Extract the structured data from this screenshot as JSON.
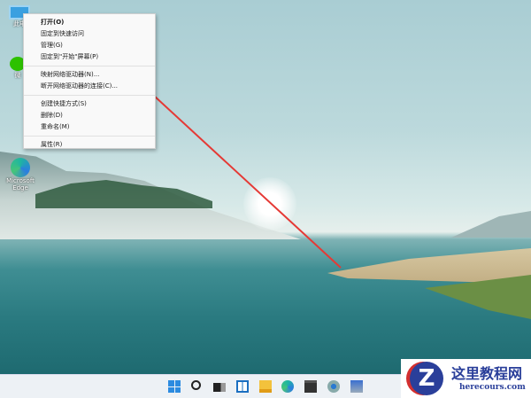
{
  "desktop": {
    "icons": [
      {
        "label": "此电",
        "icon": "this-pc-icon"
      },
      {
        "label": "微",
        "icon": "wechat-icon"
      },
      {
        "label": "Microsoft Edge",
        "icon": "edge-icon"
      }
    ]
  },
  "context_menu": {
    "groups": [
      [
        "打开(O)",
        "固定到快速访问",
        "管理(G)",
        "固定到\"开始\"屏幕(P)"
      ],
      [
        "映射网络驱动器(N)...",
        "断开网络驱动器的连接(C)..."
      ],
      [
        "创建快捷方式(S)",
        "删除(D)",
        "重命名(M)"
      ],
      [
        "属性(R)"
      ]
    ]
  },
  "annotation": {
    "arrow_color": "#e53935"
  },
  "taskbar": {
    "icons": [
      "windows-start-icon",
      "search-icon",
      "task-view-icon",
      "widgets-icon",
      "file-explorer-icon",
      "edge-icon",
      "store-icon",
      "settings-icon",
      "control-panel-icon"
    ]
  },
  "watermark": {
    "title": "这里教程网",
    "url": "herecours.com",
    "logo_letter": "Z"
  }
}
